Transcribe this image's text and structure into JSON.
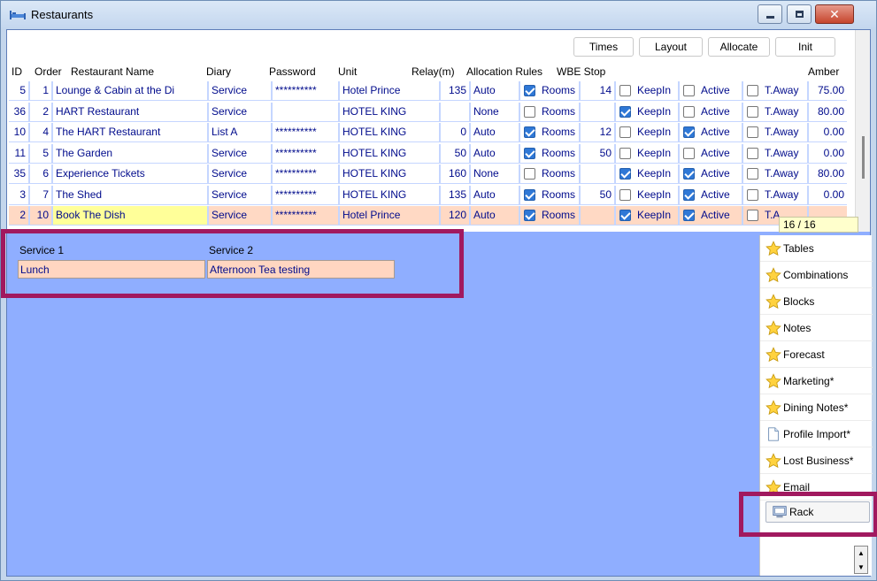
{
  "window": {
    "title": "Restaurants",
    "icon": "bed-icon",
    "controls": [
      "minimize-icon",
      "maximize-icon",
      "close-icon"
    ]
  },
  "toolbar": {
    "times": "Times",
    "layout": "Layout",
    "allocate": "Allocate",
    "init": "Init"
  },
  "columns": {
    "id": "ID",
    "order": "Order",
    "name": "Restaurant Name",
    "diary": "Diary",
    "password": "Password",
    "unit": "Unit",
    "relay": "Relay(m)",
    "allocation": "Allocation Rules",
    "wbe": "WBE Stop",
    "amber": "Amber"
  },
  "rows": [
    {
      "id": "5",
      "order": "1",
      "name": "Lounge & Cabin at the Di",
      "diary": "Service",
      "password": "**********",
      "unit": "Hotel Prince",
      "relay": "135",
      "allocation": "Auto",
      "rooms": true,
      "rooms_label": "Rooms",
      "wbe": "14",
      "keepin": false,
      "keepin_label": "KeepIn",
      "active": false,
      "active_label": "Active",
      "taway": false,
      "taway_label": "T.Away",
      "amber": "75.00"
    },
    {
      "id": "36",
      "order": "2",
      "name": "HART Restaurant",
      "diary": "Service",
      "password": "",
      "unit": "HOTEL KING",
      "relay": "",
      "allocation": "None",
      "rooms": false,
      "rooms_label": "Rooms",
      "wbe": "",
      "keepin": true,
      "keepin_label": "KeepIn",
      "active": false,
      "active_label": "Active",
      "taway": false,
      "taway_label": "T.Away",
      "amber": "80.00"
    },
    {
      "id": "10",
      "order": "4",
      "name": "The HART Restaurant",
      "diary": "List A",
      "password": "**********",
      "unit": "HOTEL KING",
      "relay": "0",
      "allocation": "Auto",
      "rooms": true,
      "rooms_label": "Rooms",
      "wbe": "12",
      "keepin": false,
      "keepin_label": "KeepIn",
      "active": true,
      "active_label": "Active",
      "taway": false,
      "taway_label": "T.Away",
      "amber": "0.00"
    },
    {
      "id": "11",
      "order": "5",
      "name": "The Garden",
      "diary": "Service",
      "password": "**********",
      "unit": "HOTEL KING",
      "relay": "50",
      "allocation": "Auto",
      "rooms": true,
      "rooms_label": "Rooms",
      "wbe": "50",
      "keepin": false,
      "keepin_label": "KeepIn",
      "active": false,
      "active_label": "Active",
      "taway": false,
      "taway_label": "T.Away",
      "amber": "0.00"
    },
    {
      "id": "35",
      "order": "6",
      "name": "Experience Tickets",
      "diary": "Service",
      "password": "**********",
      "unit": "HOTEL KING",
      "relay": "160",
      "allocation": "None",
      "rooms": false,
      "rooms_label": "Rooms",
      "wbe": "",
      "keepin": true,
      "keepin_label": "KeepIn",
      "active": true,
      "active_label": "Active",
      "taway": false,
      "taway_label": "T.Away",
      "amber": "80.00"
    },
    {
      "id": "3",
      "order": "7",
      "name": "The Shed",
      "diary": "Service",
      "password": "**********",
      "unit": "HOTEL KING",
      "relay": "135",
      "allocation": "Auto",
      "rooms": true,
      "rooms_label": "Rooms",
      "wbe": "50",
      "keepin": false,
      "keepin_label": "KeepIn",
      "active": true,
      "active_label": "Active",
      "taway": false,
      "taway_label": "T.Away",
      "amber": "0.00"
    },
    {
      "id": "2",
      "order": "10",
      "name": "Book The Dish",
      "diary": "Service",
      "password": "**********",
      "unit": "Hotel Prince",
      "relay": "120",
      "allocation": "Auto",
      "rooms": true,
      "rooms_label": "Rooms",
      "wbe": "",
      "keepin": true,
      "keepin_label": "KeepIn",
      "active": true,
      "active_label": "Active",
      "taway": false,
      "taway_label": "T.A",
      "amber": "",
      "selected": true
    }
  ],
  "record_counter": "16 / 16",
  "services": {
    "service1_label": "Service 1",
    "service1_value": "Lunch",
    "service2_label": "Service 2",
    "service2_value": "Afternoon Tea testing"
  },
  "side_menu": [
    {
      "label": "Tables",
      "icon": "star-icon"
    },
    {
      "label": "Combinations",
      "icon": "star-icon"
    },
    {
      "label": "Blocks",
      "icon": "star-icon"
    },
    {
      "label": "Notes",
      "icon": "star-icon"
    },
    {
      "label": "Forecast",
      "icon": "star-icon"
    },
    {
      "label": "Marketing*",
      "icon": "star-icon"
    },
    {
      "label": "Dining Notes*",
      "icon": "star-icon"
    },
    {
      "label": "Profile Import*",
      "icon": "document-icon"
    },
    {
      "label": "Lost Business*",
      "icon": "star-icon"
    },
    {
      "label": "Email",
      "icon": "star-icon"
    },
    {
      "label": "Rack",
      "icon": "rack-icon"
    }
  ],
  "colors": {
    "highlight": "#a1195f",
    "content_bg": "#8faeff",
    "selected_row": "#ffd9c4",
    "cell_text": "#000b8c"
  }
}
